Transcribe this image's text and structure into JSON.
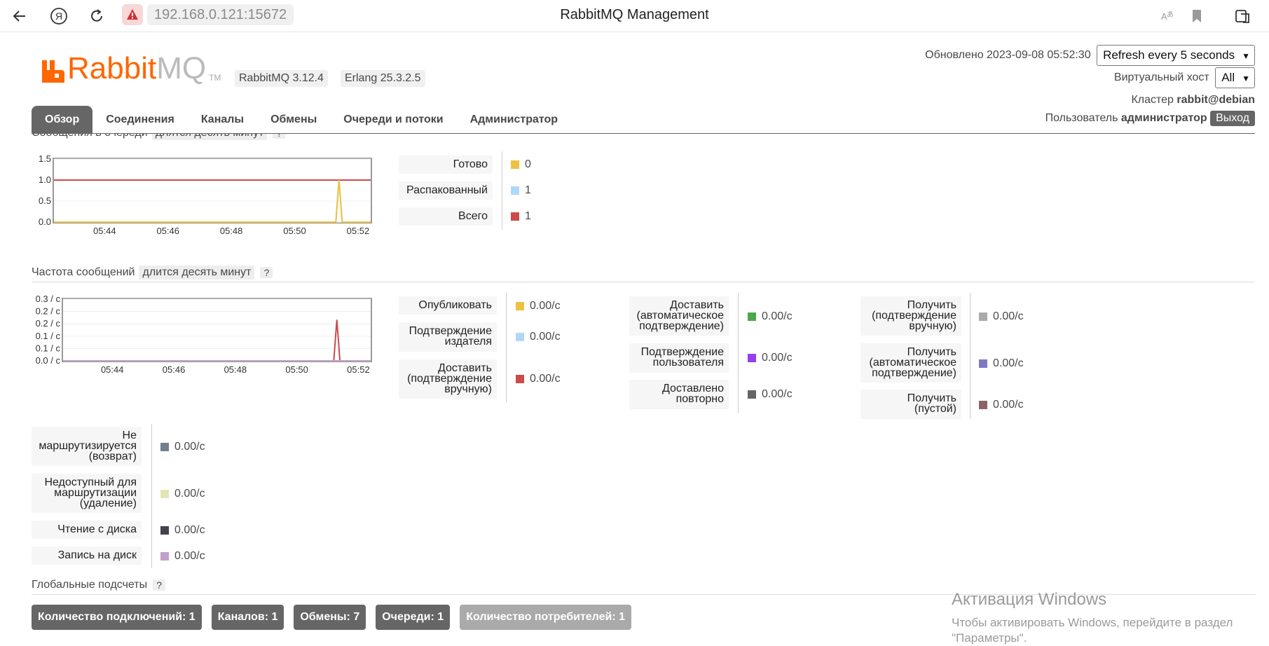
{
  "browser": {
    "url": "192.168.0.121:15672",
    "title": "RabbitMQ Management"
  },
  "header": {
    "logo_word_1": "Rabbit",
    "logo_word_2": "MQ",
    "logo_tm": "TM",
    "version_rabbit": "RabbitMQ 3.12.4",
    "version_erlang": "Erlang 25.3.2.5",
    "updated_label": "Обновлено 2023-09-08 05:52:30",
    "refresh_select": "Refresh every 5 seconds",
    "vhost_label": "Виртуальный хост",
    "vhost_select": "All",
    "cluster_label": "Кластер",
    "cluster_value": "rabbit@debian",
    "user_label": "Пользователь",
    "user_value": "администратор",
    "logout": "Выход"
  },
  "tabs": [
    "Обзор",
    "Соединения",
    "Каналы",
    "Обмены",
    "Очереди и потоки",
    "Администратор"
  ],
  "queued": {
    "heading": "Сообщения в очереди",
    "period": "длятся десять минут",
    "help": "?",
    "legend": [
      {
        "label": "Готово",
        "value": "0",
        "color": "#edc240"
      },
      {
        "label": "Распакованный",
        "value": "1",
        "color": "#afd8f8"
      },
      {
        "label": "Всего",
        "value": "1",
        "color": "#cb4b4b"
      }
    ]
  },
  "rates": {
    "heading": "Частота сообщений",
    "period": "длится десять минут",
    "help": "?",
    "legend_col1": [
      {
        "label": "Опубликовать",
        "value": "0.00/с",
        "color": "#edc240"
      },
      {
        "label": "Подтверждение издателя",
        "value": "0.00/с",
        "color": "#afd8f8"
      },
      {
        "label": "Доставить (подтверждение вручную)",
        "value": "0.00/с",
        "color": "#cb4b4b"
      }
    ],
    "legend_col2": [
      {
        "label": "Доставить (автоматическое подтверждение)",
        "value": "0.00/с",
        "color": "#4da74d"
      },
      {
        "label": "Подтверждение пользователя",
        "value": "0.00/с",
        "color": "#9440ed"
      },
      {
        "label": "Доставлено повторно",
        "value": "0.00/с",
        "color": "#666666"
      }
    ],
    "legend_col3": [
      {
        "label": "Получить (подтверждение вручную)",
        "value": "0.00/с",
        "color": "#aaaaaa"
      },
      {
        "label": "Получить (автоматическое подтверждение)",
        "value": "0.00/с",
        "color": "#7c79c3"
      },
      {
        "label": "Получить (пустой)",
        "value": "0.00/с",
        "color": "#8a6464"
      }
    ],
    "legend_col4": [
      {
        "label": "Не маршрутизируется (возврат)",
        "value": "0.00/с",
        "color": "#708090"
      },
      {
        "label": "Недоступный для маршрутизации (удаление)",
        "value": "0.00/с",
        "color": "#e5e4b4"
      },
      {
        "label": "Чтение с диска",
        "value": "0.00/с",
        "color": "#424250"
      },
      {
        "label": "Запись на диск",
        "value": "0.00/с",
        "color": "#c0a0c8"
      }
    ]
  },
  "global": {
    "heading": "Глобальные подсчеты",
    "help": "?",
    "totals": [
      "Количество подключений: 1",
      "Каналов: 1",
      "Обмены: 7",
      "Очереди: 1",
      "Количество потребителей: 1"
    ]
  },
  "watermark": {
    "line1": "Активация Windows",
    "line2": "Чтобы активировать Windows, перейдите в раздел",
    "line3": "\"Параметры\"."
  },
  "chart_data": [
    {
      "type": "line",
      "title": "Сообщения в очереди",
      "x_ticks": [
        "05:44",
        "05:46",
        "05:48",
        "05:50",
        "05:52"
      ],
      "y_ticks": [
        "0.0",
        "0.5",
        "1.0",
        "1.5"
      ],
      "ylim": [
        0,
        1.5
      ],
      "x_range_minutes": [
        -10,
        0
      ],
      "series": [
        {
          "name": "Всего",
          "color": "#cb4b4b",
          "points": [
            [
              -10,
              1
            ],
            [
              0,
              1
            ]
          ]
        },
        {
          "name": "Распакованный",
          "color": "#afd8f8",
          "points": [
            [
              -10,
              0
            ],
            [
              -1.1,
              0
            ],
            [
              -1.0,
              1
            ],
            [
              -0.9,
              0
            ],
            [
              0,
              0
            ]
          ]
        },
        {
          "name": "Готово",
          "color": "#edc240",
          "points": [
            [
              -10,
              0
            ],
            [
              -1.1,
              0
            ],
            [
              -1.0,
              1
            ],
            [
              -0.9,
              0
            ],
            [
              0,
              0
            ]
          ]
        }
      ]
    },
    {
      "type": "line",
      "title": "Частота сообщений",
      "x_ticks": [
        "05:44",
        "05:46",
        "05:48",
        "05:50",
        "05:52"
      ],
      "y_ticks": [
        "0.0 / с",
        "0.1 / с",
        "0.1 / с",
        "0.2 / с",
        "0.2 / с",
        "0.3 / с"
      ],
      "ylim": [
        0,
        0.3
      ],
      "x_range_minutes": [
        -10,
        0
      ],
      "series": [
        {
          "name": "Доставить (подтверждение вручную)",
          "color": "#cb4b4b",
          "points": [
            [
              -10,
              0
            ],
            [
              -1.2,
              0
            ],
            [
              -1.1,
              0.2
            ],
            [
              -1.0,
              0
            ],
            [
              0,
              0
            ]
          ]
        },
        {
          "name": "Запись на диск",
          "color": "#c0a0c8",
          "points": [
            [
              -10,
              0
            ],
            [
              0,
              0
            ]
          ]
        }
      ]
    }
  ]
}
